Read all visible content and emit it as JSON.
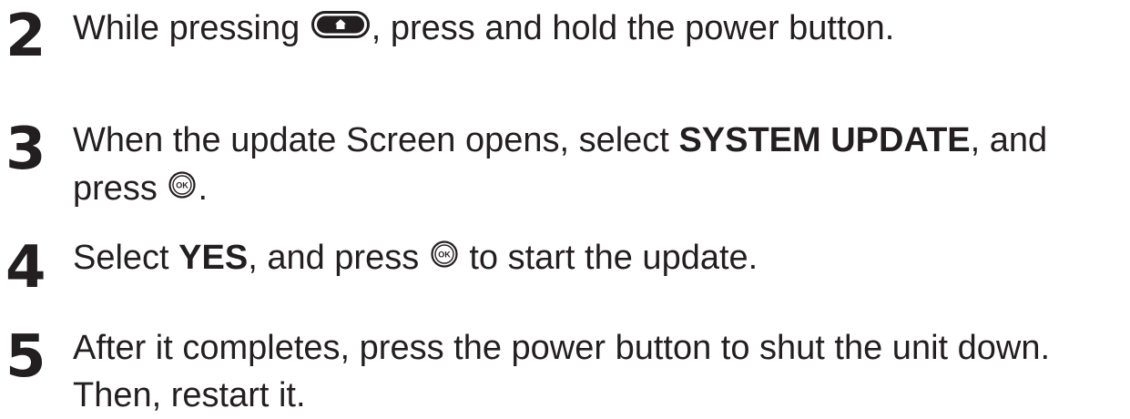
{
  "steps": [
    {
      "number": "2",
      "before_icon": "While pressing ",
      "icon": "home-button-icon",
      "after_icon": ", press and hold the power button."
    },
    {
      "number": "3",
      "line1_before": "When the update Screen opens, select ",
      "line1_bold": "SYSTEM UPDATE",
      "line1_after": ", and",
      "line2_before": "press ",
      "icon": "ok-button-icon",
      "line2_after": "."
    },
    {
      "number": "4",
      "before_bold": "Select ",
      "bold": "YES",
      "after_bold": ", and press ",
      "icon": "ok-button-icon",
      "after_icon": " to start the update."
    },
    {
      "number": "5",
      "line1": "After it completes, press the power button to shut the unit down.",
      "line2": "Then, restart it."
    }
  ]
}
